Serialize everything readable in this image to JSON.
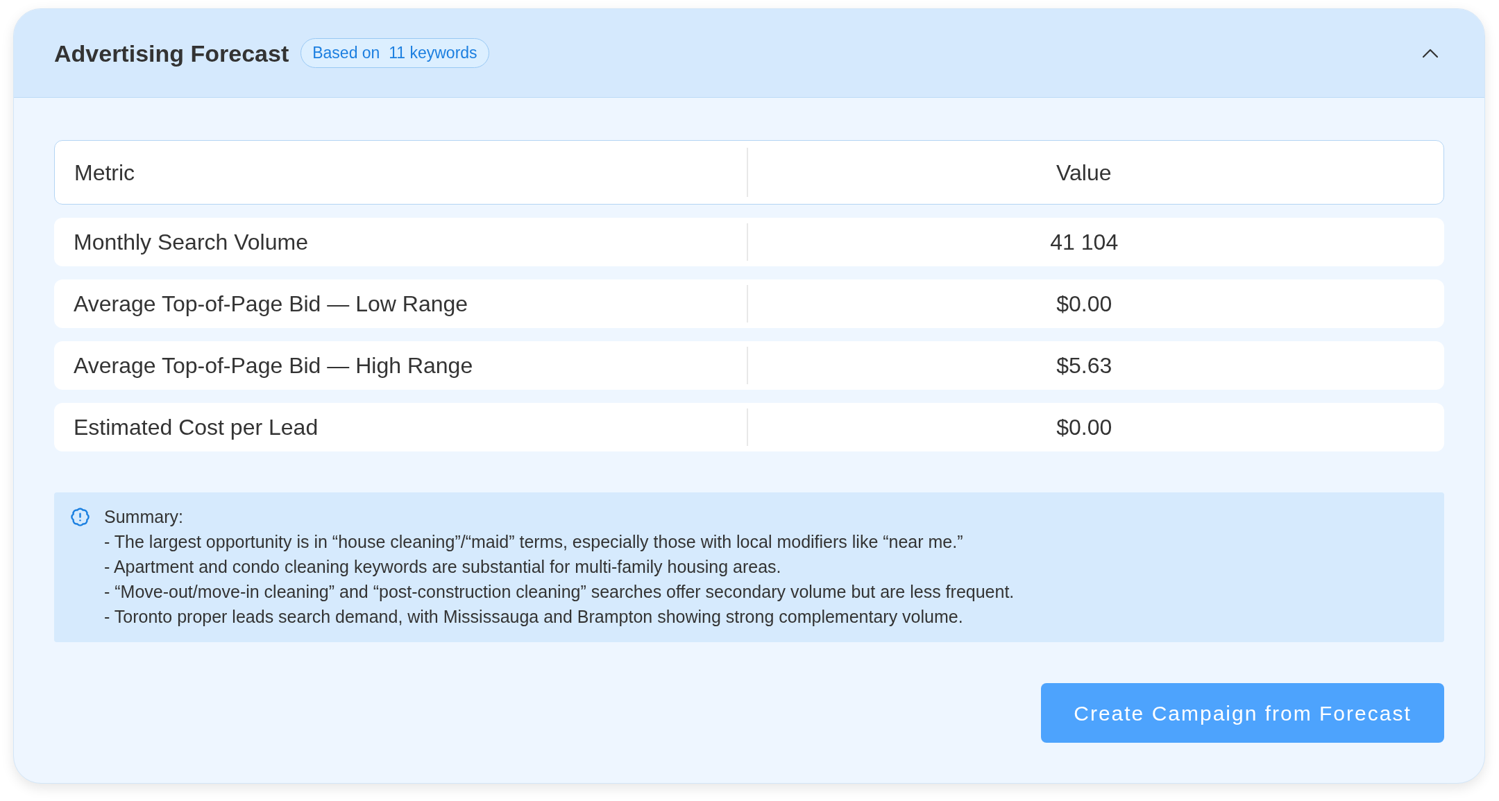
{
  "panel": {
    "title": "Advertising Forecast",
    "badge": "Based on  11 keywords",
    "expanded": true
  },
  "table": {
    "columns": [
      "Metric",
      "Value"
    ],
    "rows": [
      {
        "metric": "Monthly Search Volume",
        "value": "41 104"
      },
      {
        "metric": "Average Top-of-Page Bid — Low Range",
        "value": "$0.00"
      },
      {
        "metric": "Average Top-of-Page Bid — High Range",
        "value": "$5.63"
      },
      {
        "metric": "Estimated Cost per Lead",
        "value": "$0.00"
      }
    ]
  },
  "summary": {
    "heading": "Summary:",
    "lines": [
      "- The largest opportunity is in “house cleaning”/“maid” terms, especially those with local modifiers like “near me.”",
      "- Apartment and condo cleaning keywords are substantial for multi-family housing areas.",
      "- “Move-out/move-in cleaning” and “post-construction cleaning” searches offer secondary volume but are less frequent.",
      "- Toronto proper leads search demand, with Mississauga and Brampton showing strong complementary volume."
    ]
  },
  "action_button": "Create Campaign from Forecast"
}
